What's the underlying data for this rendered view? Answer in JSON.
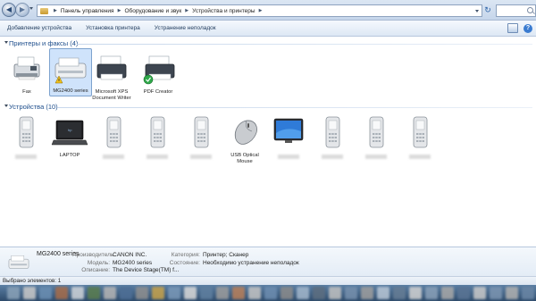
{
  "address": {
    "crumbs": [
      "Панель управления",
      "Оборудование и звук",
      "Устройства и принтеры"
    ]
  },
  "commands": [
    {
      "label": "Добавление устройства"
    },
    {
      "label": "Установка принтера"
    },
    {
      "label": "Устранение неполадок"
    }
  ],
  "printers_group": {
    "title": "Принтеры и факсы (4)",
    "items": [
      {
        "label": "Fax",
        "icon": "fax-icon"
      },
      {
        "label": "MG2400 series",
        "icon": "inkjet-printer-icon",
        "selected": true,
        "warning": true
      },
      {
        "label": "Microsoft XPS Document Writer",
        "icon": "printer-icon"
      },
      {
        "label": "PDF Creator",
        "icon": "printer-icon",
        "default": true
      }
    ]
  },
  "devices_group": {
    "title": "Устройства (10)",
    "items": [
      {
        "label": "",
        "icon": "phone-icon",
        "hidden": true
      },
      {
        "label": "LAPTOP",
        "icon": "laptop-icon"
      },
      {
        "label": "",
        "icon": "phone-icon",
        "hidden": true
      },
      {
        "label": "",
        "icon": "phone-icon",
        "hidden": true
      },
      {
        "label": "",
        "icon": "phone-icon",
        "hidden": true
      },
      {
        "label": "USB Optical Mouse",
        "icon": "mouse-icon"
      },
      {
        "label": "",
        "icon": "monitor-icon",
        "hidden": true
      },
      {
        "label": "",
        "icon": "phone-icon",
        "hidden": true
      },
      {
        "label": "",
        "icon": "phone-icon",
        "hidden": true
      },
      {
        "label": "",
        "icon": "phone-icon",
        "hidden": true
      }
    ]
  },
  "details": {
    "name": "MG2400 series",
    "manufacturer_key": "Производитель:",
    "manufacturer": "CANON INC.",
    "model_key": "Модель:",
    "model": "MG2400 series",
    "description_key": "Описание:",
    "description": "The Device Stage(TM) f...",
    "category_key": "Категория:",
    "category": "Принтер; Сканер",
    "state_key": "Состояние:",
    "state": "Необходимо устранение неполадок"
  },
  "status": {
    "selected_text": "Выбрано элементов: 1"
  },
  "colors": {
    "accent": "#1e4e8c",
    "selection": "#cfe3fb",
    "taskbar": "#2e4b6b"
  }
}
